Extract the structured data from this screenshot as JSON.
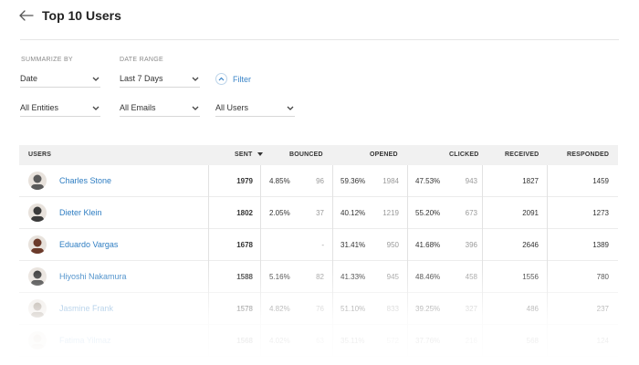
{
  "header": {
    "title": "Top 10 Users"
  },
  "controls": {
    "summarize_label": "SUMMARIZE BY",
    "summarize_value": "Date",
    "date_range_label": "DATE RANGE",
    "date_range_value": "Last 7 Days",
    "filter_label": "Filter",
    "entities_value": "All Entities",
    "emails_value": "All Emails",
    "users_value": "All Users"
  },
  "table": {
    "columns": {
      "users": "USERS",
      "sent": "SENT",
      "bounced": "BOUNCED",
      "opened": "OPENED",
      "clicked": "CLICKED",
      "received": "RECEIVED",
      "responded": "RESPONDED"
    },
    "rows": [
      {
        "name": "Charles Stone",
        "sent": "1979",
        "bounced_pct": "4.85%",
        "bounced": "96",
        "opened_pct": "59.36%",
        "opened": "1984",
        "clicked_pct": "47.53%",
        "clicked": "943",
        "received": "1827",
        "responded": "1459"
      },
      {
        "name": "Dieter Klein",
        "sent": "1802",
        "bounced_pct": "2.05%",
        "bounced": "37",
        "opened_pct": "40.12%",
        "opened": "1219",
        "clicked_pct": "55.20%",
        "clicked": "673",
        "received": "2091",
        "responded": "1273"
      },
      {
        "name": "Eduardo Vargas",
        "sent": "1678",
        "bounced_pct": "",
        "bounced": "-",
        "opened_pct": "31.41%",
        "opened": "950",
        "clicked_pct": "41.68%",
        "clicked": "396",
        "received": "2646",
        "responded": "1389"
      },
      {
        "name": "Hiyoshi Nakamura",
        "sent": "1588",
        "bounced_pct": "5.16%",
        "bounced": "82",
        "opened_pct": "41.33%",
        "opened": "945",
        "clicked_pct": "48.46%",
        "clicked": "458",
        "received": "1556",
        "responded": "780"
      },
      {
        "name": "Jasmine Frank",
        "sent": "1578",
        "bounced_pct": "4.82%",
        "bounced": "76",
        "opened_pct": "51.10%",
        "opened": "833",
        "clicked_pct": "39.25%",
        "clicked": "327",
        "received": "486",
        "responded": "237"
      },
      {
        "name": "Fatima Yilmaz",
        "sent": "1568",
        "bounced_pct": "4.02%",
        "bounced": "63",
        "opened_pct": "35.11%",
        "opened": "572",
        "clicked_pct": "37.76%",
        "clicked": "216",
        "received": "568",
        "responded": "124"
      }
    ]
  },
  "colors": {
    "link": "#2e7dc2",
    "header_bg": "#f1f1f1"
  }
}
